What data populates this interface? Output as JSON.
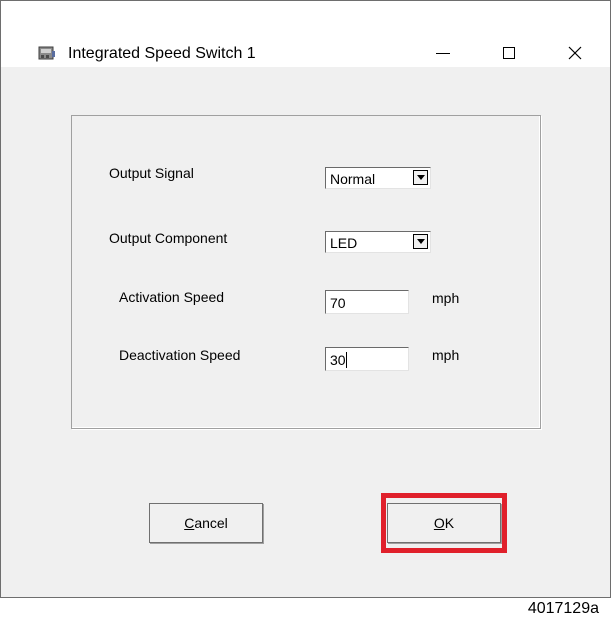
{
  "window": {
    "title": "Integrated Speed Switch 1",
    "icon": "speed-switch-app-icon",
    "controls": {
      "minimize": "—",
      "maximize": "☐",
      "close": "✕"
    }
  },
  "fields": {
    "output_signal": {
      "label": "Output Signal",
      "value": "Normal"
    },
    "output_component": {
      "label": "Output Component",
      "value": "LED"
    },
    "activation_speed": {
      "label": "Activation Speed",
      "value": "70",
      "unit": "mph"
    },
    "deactivation_speed": {
      "label": "Deactivation Speed",
      "value": "30",
      "unit": "mph"
    }
  },
  "buttons": {
    "cancel": {
      "label": "Cancel",
      "mnemonic": "C",
      "rest": "ancel"
    },
    "ok": {
      "label": "OK",
      "mnemonic": "O",
      "rest": "K"
    }
  },
  "highlight_color": "#e0202b",
  "figure_code": "4017129a"
}
